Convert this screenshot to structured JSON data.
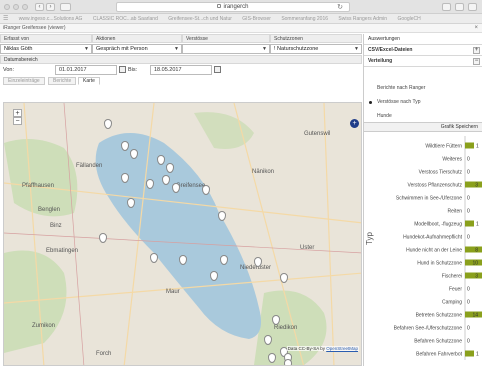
{
  "browser": {
    "url": "irangerch",
    "bookmarks": [
      "www.ingeso.c...Solutions AG",
      "CLASSIC ROC...ab Saarland",
      "Greifensee-St...ch und Natur",
      "GIS-Browser",
      "Sommeranfang 2016",
      "Swiss Rangers Admin",
      "GoogleCH"
    ],
    "menu_glyph": "☰",
    "reload_glyph": "↻",
    "colors": {
      "chrome": "#e3e3e3"
    }
  },
  "app": {
    "title": "iRanger Greifensee (viewer)",
    "close": "×"
  },
  "filters": {
    "columns": [
      {
        "header": "Erfasst von",
        "value": "Niklas Göth"
      },
      {
        "header": "Aktionen",
        "value": "Gespräch mit Person"
      },
      {
        "header": "Verstösse",
        "value": ""
      },
      {
        "header": "Schutzzonen",
        "value": "! Naturschutzzone"
      }
    ],
    "date_section_title": "Datumsbereich",
    "from_label": "Von:",
    "from_value": "01.01.2017",
    "to_label": "Bis:",
    "to_value": "18.05.2017",
    "tabs": [
      "Einzeleinträge",
      "Berichte",
      "Karte"
    ],
    "active_tab": "Karte"
  },
  "map": {
    "zoom_in": "+",
    "zoom_out": "−",
    "locate": "+",
    "places": [
      "Fällanden",
      "Pfaffhausen",
      "Benglen",
      "Binz",
      "Ebmatingen",
      "Maur",
      "Zumikon",
      "Greifensee",
      "Nänikon",
      "Uster",
      "Niederuster",
      "Riedikon",
      "Forch",
      "Gutenswil"
    ],
    "attribution_text": "Data CC-By-SA by",
    "attribution_link": "OpenStreetMap",
    "colors": {
      "water": "#a9c9dc",
      "land": "#e9e4d9",
      "forest": "#c7dcb0",
      "marker": "#ffffff"
    }
  },
  "panel": {
    "title": "Auswertungen",
    "csv": "CSV/Excel-Dateien",
    "csv_btn": "+",
    "distribution": "Verteilung",
    "distribution_btn": "−",
    "options": [
      "Berichte nach Ranger",
      "Verstösse nach Typ",
      "Hunde"
    ],
    "selected_option": "Verstösse nach Typ",
    "save_graph": "Grafik Speichern"
  },
  "chart_data": {
    "type": "bar",
    "orientation": "horizontal",
    "ylabel": "Typ",
    "categories": [
      "Wildtiere Füttern",
      "Weiteres",
      "Verstoss Tierschutz",
      "Verstoss Pflanzenschutz",
      "Schwimmen in See-/Uferzone",
      "Reiten",
      "Modellboot, -flugzeug",
      "Hundekot-Aufnahmepflicht",
      "Hunde nicht an der Leine",
      "Hund in Schutzzone",
      "Fischerei",
      "Feuer",
      "Camping",
      "Betreten Schutzzone",
      "Befahren See-/Uferschutzzone",
      "Befahren Schutzzone",
      "Befahren Fahrverbot"
    ],
    "values": [
      1,
      0,
      0,
      3,
      0,
      0,
      1,
      0,
      8,
      10,
      3,
      0,
      0,
      14,
      0,
      0,
      1
    ],
    "bar_color": "#8aa01c"
  }
}
